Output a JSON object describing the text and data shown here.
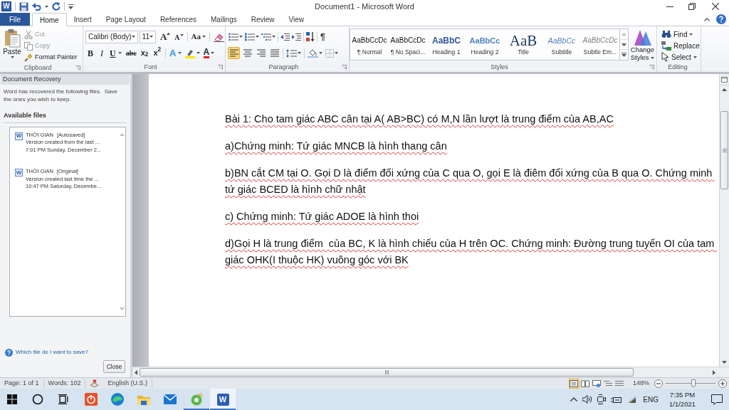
{
  "window": {
    "logo": "W",
    "title": "Document1 - Microsoft Word"
  },
  "tabs": [
    {
      "label": "File",
      "kind": "file",
      "selected": false
    },
    {
      "label": "Home",
      "kind": "tab",
      "selected": true
    },
    {
      "label": "Insert",
      "kind": "tab",
      "selected": false
    },
    {
      "label": "Page Layout",
      "kind": "tab",
      "selected": false
    },
    {
      "label": "References",
      "kind": "tab",
      "selected": false
    },
    {
      "label": "Mailings",
      "kind": "tab",
      "selected": false
    },
    {
      "label": "Review",
      "kind": "tab",
      "selected": false
    },
    {
      "label": "View",
      "kind": "tab",
      "selected": false
    }
  ],
  "ribbon": {
    "clipboard": {
      "label": "Clipboard",
      "dialog_launcher": true,
      "paste": "Paste",
      "commands": [
        {
          "label": "Cut",
          "kind": "cut",
          "disabled": true
        },
        {
          "label": "Copy",
          "kind": "copy",
          "disabled": true
        },
        {
          "label": "Format Painter",
          "kind": "painter",
          "disabled": false
        }
      ]
    },
    "font": {
      "label": "Font",
      "dialog_launcher": true,
      "family": "Calibri (Body)",
      "size": "11",
      "grow": "A",
      "shrink": "A",
      "change_case": "Aa",
      "formats": [
        {
          "label": "B",
          "kind": "bold"
        },
        {
          "label": "I",
          "kind": "italic"
        },
        {
          "label": "U",
          "kind": "underline"
        },
        {
          "label": "abc",
          "kind": "strike"
        },
        {
          "label": "x$_{2}$",
          "kind": "sub"
        },
        {
          "label": "x$^{2}$",
          "kind": "sup"
        }
      ],
      "text_effects": "A",
      "font_color": "A"
    },
    "paragraph": {
      "label": "Paragraph",
      "dialog_launcher": true,
      "show_marks": "¶",
      "alignments": [
        {
          "kind": "left",
          "selected": true
        },
        {
          "kind": "center",
          "selected": false
        },
        {
          "kind": "right",
          "selected": false
        },
        {
          "kind": "justify",
          "selected": false
        }
      ]
    },
    "styles": {
      "label": "Styles",
      "dialog_launcher": true,
      "items": [
        {
          "preview": "AaBbCcDc",
          "name": "¶ Normal",
          "kind": "normal"
        },
        {
          "preview": "AaBbCcDc",
          "name": "¶ No Spaci...",
          "kind": "plain"
        },
        {
          "preview": "AaBbC",
          "name": "Heading 1",
          "kind": "heading1"
        },
        {
          "preview": "AaBbCc",
          "name": "Heading 2",
          "kind": "heading2"
        },
        {
          "preview": "AaB",
          "name": "Title",
          "kind": "title"
        },
        {
          "preview": "AaBbCc",
          "name": "Subtitle",
          "kind": "subtitle"
        },
        {
          "preview": "AaBbCcDc",
          "name": "Subtle Em...",
          "kind": "subtle"
        }
      ],
      "change_styles": "Change Styles"
    },
    "editing": {
      "label": "Editing",
      "commands": [
        {
          "label": "Find",
          "kind": "find"
        },
        {
          "label": "Replace",
          "kind": "replace"
        },
        {
          "label": "Select",
          "kind": "select"
        }
      ]
    }
  },
  "recovery_pane": {
    "title": "Document Recovery",
    "message": "Word has recovered the following files.  Save the ones you wish to keep.",
    "files_heading": "Available files",
    "files": [
      {
        "icon": "W",
        "name": "THỜI GIAN",
        "tag": "[Autosaved]",
        "detail": "Version created from the last ...",
        "time": "7:01 PM Sunday, December 2..."
      },
      {
        "icon": "W",
        "name": "THỜI GIAN",
        "tag": "[Original]",
        "detail": "Version created last time the ...",
        "time": "10:47 PM Saturday, Decembe..."
      }
    ],
    "help_link": "Which file do I want to save?",
    "close_button": "Close"
  },
  "document": {
    "spelling_flagged": true,
    "paragraphs": [
      "Bài 1: Cho tam giác ABC cân tại A( AB>BC) có M,N lần lượt là trung điểm của AB,AC",
      "a)Chứng minh: Tứ giác MNCB là hình thang cân",
      "b)BN cắt CM tại O. Gọi D là điểm đối xứng của C qua O, gọi E là điêm đối xứng của B qua O. Chứng minh tứ giác BCED là hình chữ nhật",
      "c) Chứng minh: Tứ giác ADOE là hình thoi",
      "d)Gọi H là trung điểm  của BC, K là hình chiếu của H trên OC. Chứng minh: Đường trung tuyến OI của tam giác OHK(I thuộc HK) vuông góc với BK"
    ]
  },
  "status_bar": {
    "page": "Page: 1 of 1",
    "words": "Words: 102",
    "language": "English (U.S.)",
    "views": [
      {
        "kind": "print",
        "selected": true
      },
      {
        "kind": "reading",
        "selected": false
      },
      {
        "kind": "web",
        "selected": false
      },
      {
        "kind": "outline",
        "selected": false
      },
      {
        "kind": "draft",
        "selected": false
      }
    ],
    "zoom": "148%",
    "zoom_slider": {
      "level": 0.55
    }
  },
  "taskbar": {
    "apps": [
      {
        "kind": "power",
        "running": false,
        "active": false
      },
      {
        "kind": "swirl",
        "running": false,
        "active": false
      },
      {
        "kind": "folder",
        "running": false,
        "active": false
      },
      {
        "kind": "mail",
        "running": false,
        "active": false
      },
      {
        "kind": "ring",
        "running": true,
        "active": false
      },
      {
        "kind": "word",
        "label": "W",
        "running": true,
        "active": true
      }
    ],
    "language": "ENG",
    "time": "7:35 PM",
    "date": "1/1/2021"
  }
}
